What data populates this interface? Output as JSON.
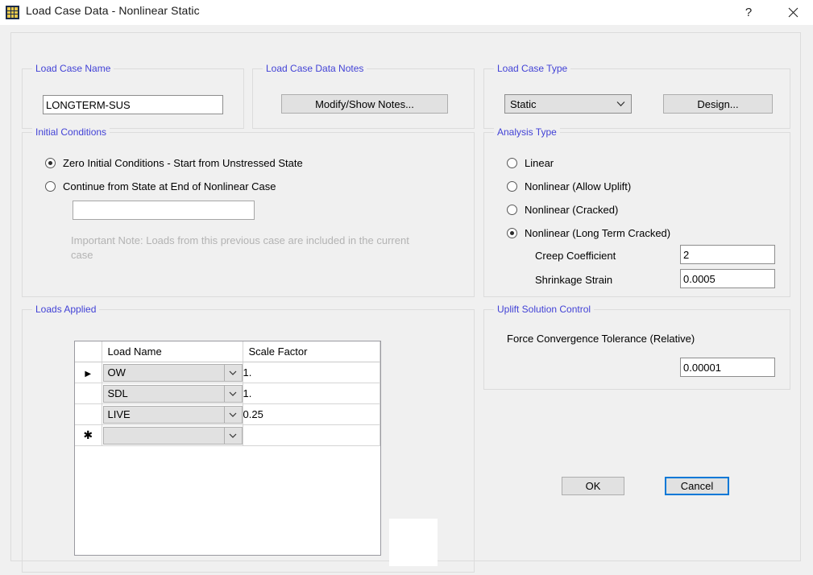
{
  "window": {
    "title": "Load Case Data - Nonlinear Static",
    "app_icon": "etabs-grid-icon",
    "help_glyph": "?",
    "close_glyph": "✕"
  },
  "load_case_name": {
    "group_label": "Load Case Name",
    "value": "LONGTERM-SUS"
  },
  "load_case_data_notes": {
    "group_label": "Load Case Data Notes",
    "modify_button": "Modify/Show Notes..."
  },
  "load_case_type": {
    "group_label": "Load Case Type",
    "selected": "Static",
    "options": [
      "Static"
    ],
    "design_button": "Design..."
  },
  "initial_conditions": {
    "group_label": "Initial Conditions",
    "options": [
      {
        "label": "Zero Initial Conditions - Start from Unstressed State",
        "checked": true
      },
      {
        "label": "Continue from State at End of Nonlinear Case",
        "checked": false
      }
    ],
    "previous_case_value": "",
    "note": "Important Note:  Loads from this previous case are included in the current case"
  },
  "analysis_type": {
    "group_label": "Analysis Type",
    "options": [
      {
        "label": "Linear",
        "checked": false
      },
      {
        "label": "Nonlinear (Allow Uplift)",
        "checked": false
      },
      {
        "label": "Nonlinear (Cracked)",
        "checked": false
      },
      {
        "label": "Nonlinear (Long Term Cracked)",
        "checked": true
      }
    ],
    "creep_label": "Creep Coefficient",
    "creep_value": "2",
    "shrinkage_label": "Shrinkage Strain",
    "shrinkage_value": "0.0005"
  },
  "loads_applied": {
    "group_label": "Loads Applied",
    "columns": [
      "",
      "Load Name",
      "Scale Factor"
    ],
    "rows": [
      {
        "marker": "▶",
        "load_name": "OW",
        "scale_factor": "1."
      },
      {
        "marker": "",
        "load_name": "SDL",
        "scale_factor": "1."
      },
      {
        "marker": "",
        "load_name": "LIVE",
        "scale_factor": "0.25"
      },
      {
        "marker": "✱",
        "load_name": "",
        "scale_factor": ""
      }
    ]
  },
  "uplift_solution_control": {
    "group_label": "Uplift Solution Control",
    "tolerance_label": "Force Convergence Tolerance (Relative)",
    "tolerance_value": "0.00001"
  },
  "footer": {
    "ok_button": "OK",
    "cancel_button": "Cancel"
  },
  "colors": {
    "group_label": "#4242d6",
    "dialog_bg": "#f0f0f0",
    "focus_border": "#0078d7",
    "disabled_text": "#b3b3b3"
  }
}
